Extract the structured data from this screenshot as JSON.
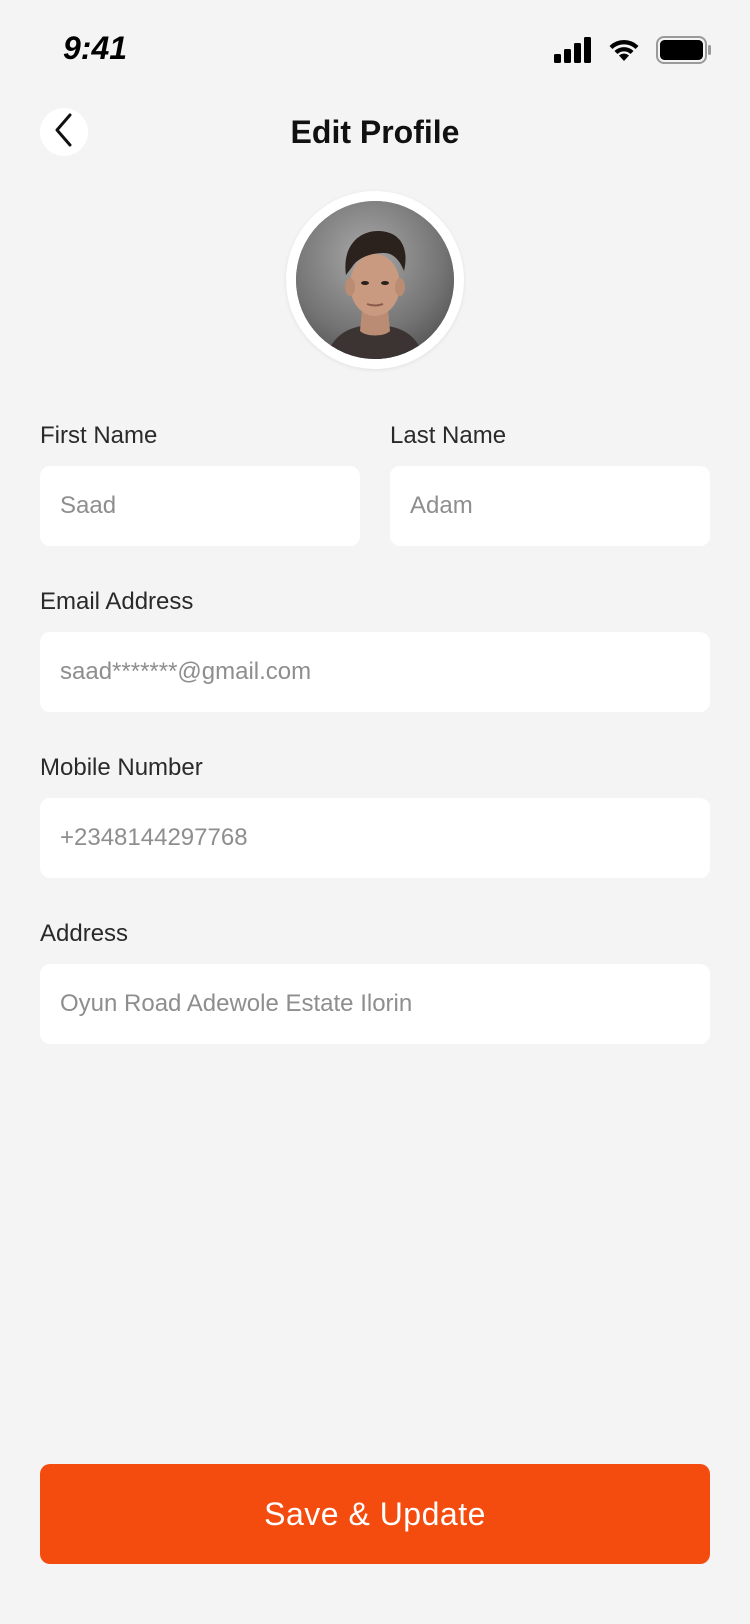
{
  "status_bar": {
    "time": "9:41",
    "icons": [
      "cellular-signal-icon",
      "wifi-icon",
      "battery-icon"
    ]
  },
  "header": {
    "back_icon": "chevron-left-icon",
    "title": "Edit Profile"
  },
  "profile": {
    "avatar": "profile-photo"
  },
  "form": {
    "first_name": {
      "label": "First Name",
      "value": "Saad"
    },
    "last_name": {
      "label": "Last Name",
      "value": "Adam"
    },
    "email": {
      "label": "Email Address",
      "value": "saad*******@gmail.com"
    },
    "mobile": {
      "label": "Mobile Number",
      "value": "+2348144297768"
    },
    "address": {
      "label": "Address",
      "value": "Oyun Road Adewole Estate Ilorin"
    }
  },
  "actions": {
    "save_label": "Save & Update"
  },
  "colors": {
    "background": "#f4f4f4",
    "accent": "#f44c0f",
    "field_background": "#ffffff",
    "placeholder_text": "#8e8e8e"
  }
}
